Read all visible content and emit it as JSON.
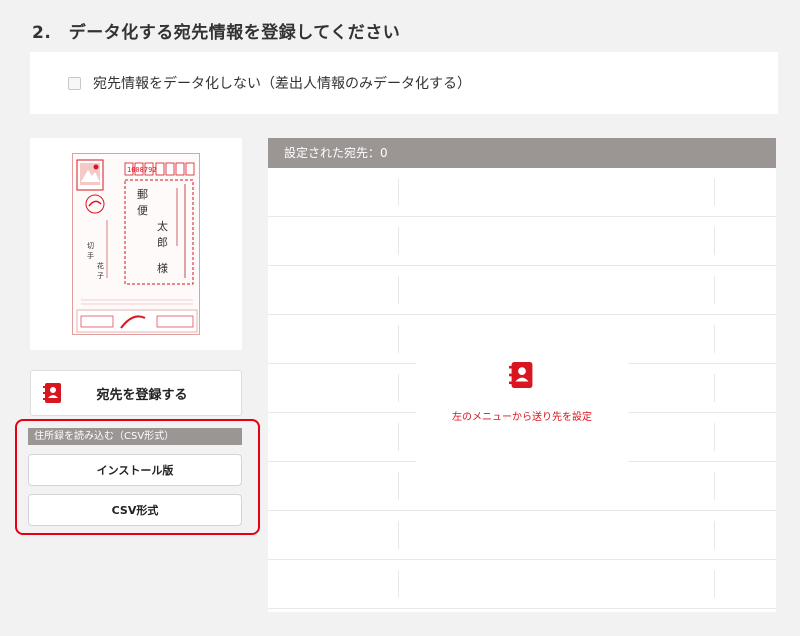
{
  "section": {
    "title": "2.　データ化する宛先情報を登録してください"
  },
  "option": {
    "checkbox_label": "宛先情報をデータ化しない（差出人情報のみデータ化する）",
    "checked": false
  },
  "preview": {
    "postal_code": "1008792",
    "recipient_name": "郵便　太郎",
    "honorific": "様",
    "sender_name": "切手　花子"
  },
  "sidebar": {
    "register_label": "宛先を登録する",
    "csv_header": "住所録を読み込む（CSV形式）",
    "install_label": "インストール版",
    "csv_label": "CSV形式"
  },
  "destinations": {
    "header": "設定された宛先：0",
    "empty_message": "左のメニューから送り先を設定"
  },
  "colors": {
    "accent": "#d9151f",
    "highlight_border": "#e60012",
    "header_bg": "#9b9593"
  }
}
